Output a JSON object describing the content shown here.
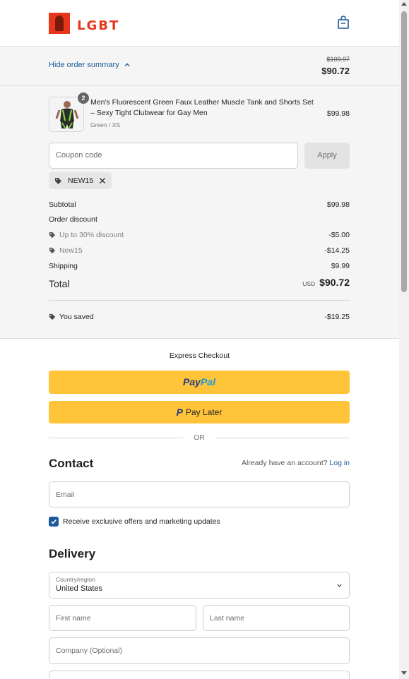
{
  "header": {
    "logo_text": "LGBT",
    "cart_icon": "shopping-bag-icon"
  },
  "summary_bar": {
    "toggle_label": "Hide order summary",
    "original_total": "$109.97",
    "total": "$90.72"
  },
  "product": {
    "quantity": "2",
    "name": "Men's Fluorescent Green Faux Leather Muscle Tank and Shorts Set – Sexy Tight Clubwear for Gay Men",
    "variant": "Green / XS",
    "price": "$99.98"
  },
  "coupon": {
    "placeholder": "Coupon code",
    "apply_label": "Apply",
    "applied_code": "NEW15"
  },
  "totals": {
    "subtotal_label": "Subtotal",
    "subtotal": "$99.98",
    "order_discount_label": "Order discount",
    "discounts": [
      {
        "label": "Up to 30% discount",
        "amount": "-$5.00"
      },
      {
        "label": "New15",
        "amount": "-$14.25"
      }
    ],
    "shipping_label": "Shipping",
    "shipping": "$9.99",
    "total_label": "Total",
    "currency": "USD",
    "total": "$90.72",
    "saved_label": "You saved",
    "saved": "-$19.25"
  },
  "express": {
    "title": "Express Checkout",
    "paypal_part1": "Pay",
    "paypal_part2": "Pal",
    "paylater_icon": "P",
    "paylater_label": "Pay Later",
    "or_label": "OR"
  },
  "contact": {
    "heading": "Contact",
    "account_prompt": "Already have an account?",
    "login_link": "Log in",
    "email_placeholder": "Email",
    "marketing_label": "Receive exclusive offers and marketing updates",
    "marketing_checked": true
  },
  "delivery": {
    "heading": "Delivery",
    "country_label": "Country/region",
    "country_value": "United States",
    "first_name_placeholder": "First name",
    "last_name_placeholder": "Last name",
    "company_placeholder": "Company (Optional)"
  },
  "colors": {
    "link": "#1a5a9a",
    "paypal_yellow": "#ffc439",
    "brand_red": "#e8361c"
  }
}
